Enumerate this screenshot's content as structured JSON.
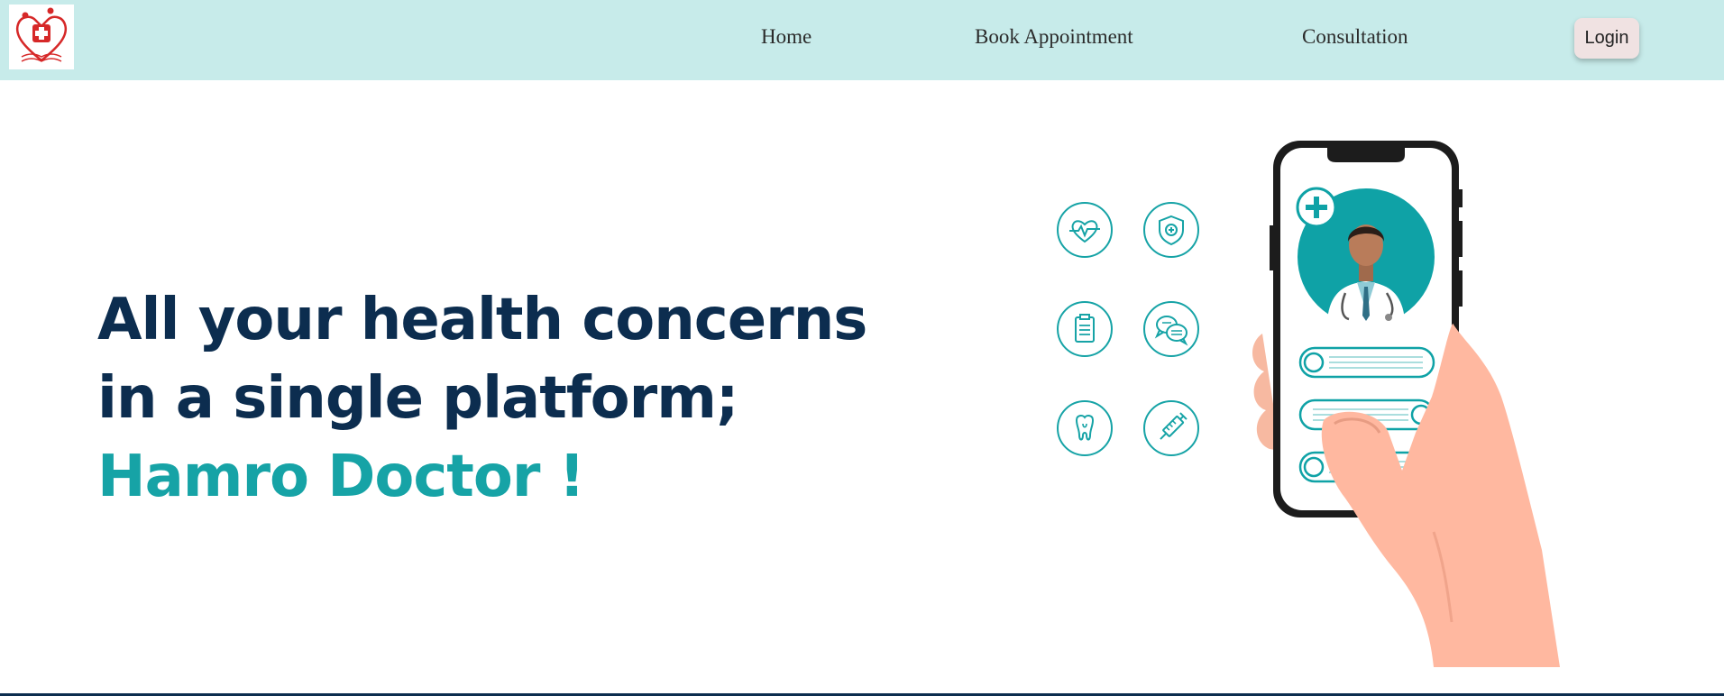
{
  "navbar": {
    "logo": "hamro-doctor-logo",
    "links": [
      "Home",
      "Book Appointment",
      "Consultation"
    ],
    "login_label": "Login"
  },
  "hero": {
    "line1": "All your health concerns",
    "line2": "in a single platform;",
    "line3": "Hamro Doctor !"
  },
  "icons": [
    "heart-pulse-icon",
    "shield-plus-icon",
    "clipboard-icon",
    "chat-bubbles-icon",
    "tooth-icon",
    "syringe-icon"
  ],
  "colors": {
    "navbar_bg": "#c7ebea",
    "heading": "#0c2d4f",
    "accent": "#16a3a6",
    "login_bg": "#f0e2e2"
  }
}
